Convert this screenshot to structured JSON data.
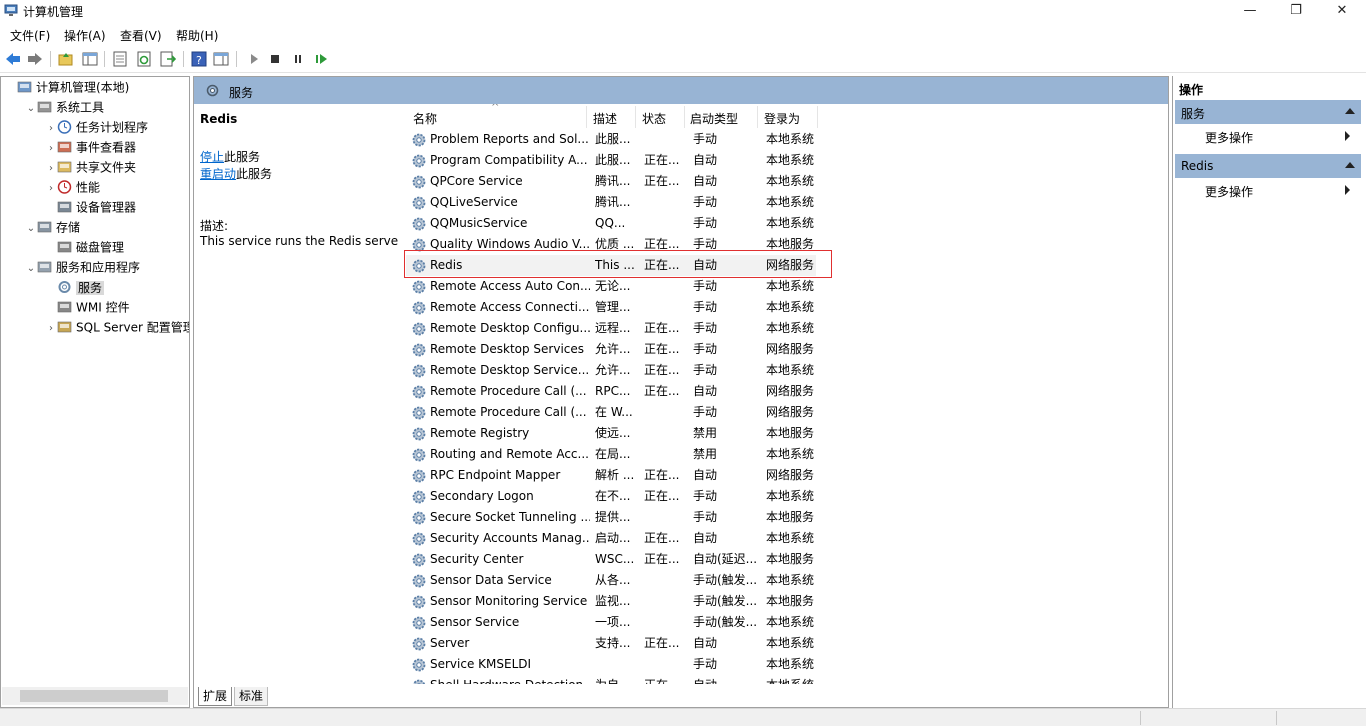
{
  "window": {
    "title": "计算机管理",
    "minimize_icon": "minimize-icon",
    "restore_icon": "restore-icon",
    "close_icon": "close-icon"
  },
  "menu": {
    "file": "文件(F)",
    "action": "操作(A)",
    "view": "查看(V)",
    "help": "帮助(H)"
  },
  "toolbar_icons": [
    "back-icon",
    "forward-icon",
    "up-icon",
    "show-hide-tree-icon",
    "properties-icon",
    "refresh-icon",
    "export-icon",
    "help-icon",
    "show-hide-action-icon",
    "play-icon",
    "stop-icon",
    "pause-icon",
    "resume-icon"
  ],
  "tree": {
    "items": [
      {
        "label": "计算机管理(本地)",
        "icon": "computer-management-icon",
        "level": 0,
        "expander": ""
      },
      {
        "label": "系统工具",
        "icon": "tools-icon",
        "level": 1,
        "expander": "open"
      },
      {
        "label": "任务计划程序",
        "icon": "clock-icon",
        "level": 2,
        "expander": "closed"
      },
      {
        "label": "事件查看器",
        "icon": "event-viewer-icon",
        "level": 2,
        "expander": "closed"
      },
      {
        "label": "共享文件夹",
        "icon": "shared-folder-icon",
        "level": 2,
        "expander": "closed"
      },
      {
        "label": "性能",
        "icon": "performance-icon",
        "level": 2,
        "expander": "closed"
      },
      {
        "label": "设备管理器",
        "icon": "device-manager-icon",
        "level": 2,
        "expander": ""
      },
      {
        "label": "存储",
        "icon": "storage-icon",
        "level": 1,
        "expander": "open"
      },
      {
        "label": "磁盘管理",
        "icon": "disk-icon",
        "level": 2,
        "expander": ""
      },
      {
        "label": "服务和应用程序",
        "icon": "services-apps-icon",
        "level": 1,
        "expander": "open"
      },
      {
        "label": "服务",
        "icon": "gear-icon",
        "level": 2,
        "expander": "",
        "selected": true
      },
      {
        "label": "WMI 控件",
        "icon": "wmi-icon",
        "level": 2,
        "expander": ""
      },
      {
        "label": "SQL Server 配置管理器",
        "icon": "sql-server-icon",
        "level": 2,
        "expander": "closed"
      }
    ]
  },
  "center": {
    "header": "服务",
    "selected_name": "Redis",
    "stop_link": "停止",
    "stop_suffix": "此服务",
    "restart_link": "重启动",
    "restart_suffix": "此服务",
    "desc_label": "描述:",
    "desc_text": "This service runs the Redis server",
    "columns": [
      "名称",
      "描述",
      "状态",
      "启动类型",
      "登录为"
    ],
    "rows": [
      [
        "Problem Reports and Sol...",
        "此服...",
        "",
        "手动",
        "本地系统"
      ],
      [
        "Program Compatibility A...",
        "此服...",
        "正在...",
        "自动",
        "本地系统"
      ],
      [
        "QPCore Service",
        "腾讯...",
        "正在...",
        "自动",
        "本地系统"
      ],
      [
        "QQLiveService",
        "腾讯...",
        "",
        "手动",
        "本地系统"
      ],
      [
        "QQMusicService",
        "QQ...",
        "",
        "手动",
        "本地系统"
      ],
      [
        "Quality Windows Audio V...",
        "优质 ...",
        "正在...",
        "手动",
        "本地服务"
      ],
      [
        "Redis",
        "This ...",
        "正在...",
        "自动",
        "网络服务"
      ],
      [
        "Remote Access Auto Con...",
        "无论...",
        "",
        "手动",
        "本地系统"
      ],
      [
        "Remote Access Connecti...",
        "管理...",
        "",
        "手动",
        "本地系统"
      ],
      [
        "Remote Desktop Configu...",
        "远程...",
        "正在...",
        "手动",
        "本地系统"
      ],
      [
        "Remote Desktop Services",
        "允许...",
        "正在...",
        "手动",
        "网络服务"
      ],
      [
        "Remote Desktop Service...",
        "允许...",
        "正在...",
        "手动",
        "本地系统"
      ],
      [
        "Remote Procedure Call (...",
        "RPC...",
        "正在...",
        "自动",
        "网络服务"
      ],
      [
        "Remote Procedure Call (...",
        "在 W...",
        "",
        "手动",
        "网络服务"
      ],
      [
        "Remote Registry",
        "使远...",
        "",
        "禁用",
        "本地服务"
      ],
      [
        "Routing and Remote Acc...",
        "在局...",
        "",
        "禁用",
        "本地系统"
      ],
      [
        "RPC Endpoint Mapper",
        "解析 ...",
        "正在...",
        "自动",
        "网络服务"
      ],
      [
        "Secondary Logon",
        "在不...",
        "正在...",
        "手动",
        "本地系统"
      ],
      [
        "Secure Socket Tunneling ...",
        "提供...",
        "",
        "手动",
        "本地服务"
      ],
      [
        "Security Accounts Manag...",
        "启动...",
        "正在...",
        "自动",
        "本地系统"
      ],
      [
        "Security Center",
        "WSC...",
        "正在...",
        "自动(延迟...",
        "本地服务"
      ],
      [
        "Sensor Data Service",
        "从各...",
        "",
        "手动(触发...",
        "本地系统"
      ],
      [
        "Sensor Monitoring Service",
        "监视...",
        "",
        "手动(触发...",
        "本地服务"
      ],
      [
        "Sensor Service",
        "一项...",
        "",
        "手动(触发...",
        "本地系统"
      ],
      [
        "Server",
        "支持...",
        "正在...",
        "自动",
        "本地系统"
      ],
      [
        "Service KMSELDI",
        "",
        "",
        "手动",
        "本地系统"
      ],
      [
        "Shell Hardware Detection",
        "为自...",
        "正在...",
        "自动",
        "本地系统"
      ]
    ],
    "selected_row": 6,
    "tabs": [
      "扩展",
      "标准"
    ]
  },
  "actions": {
    "title": "操作",
    "sections": [
      {
        "header": "服务",
        "item": "更多操作"
      },
      {
        "header": "Redis",
        "item": "更多操作"
      }
    ]
  }
}
